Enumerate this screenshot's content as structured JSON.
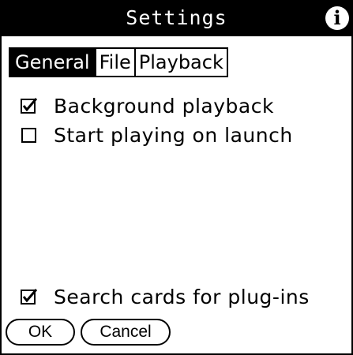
{
  "dialog": {
    "title": "Settings",
    "info_icon": "info-icon"
  },
  "tabs": [
    {
      "label": "General",
      "active": true
    },
    {
      "label": "File",
      "active": false
    },
    {
      "label": "Playback",
      "active": false
    }
  ],
  "options": [
    {
      "label": "Background playback",
      "checked": true
    },
    {
      "label": "Start playing on launch",
      "checked": false
    },
    {
      "label": "Search cards for plug-ins",
      "checked": true
    }
  ],
  "buttons": {
    "ok_label": "OK",
    "cancel_label": "Cancel"
  },
  "colors": {
    "foreground": "#000000",
    "background": "#ffffff"
  }
}
